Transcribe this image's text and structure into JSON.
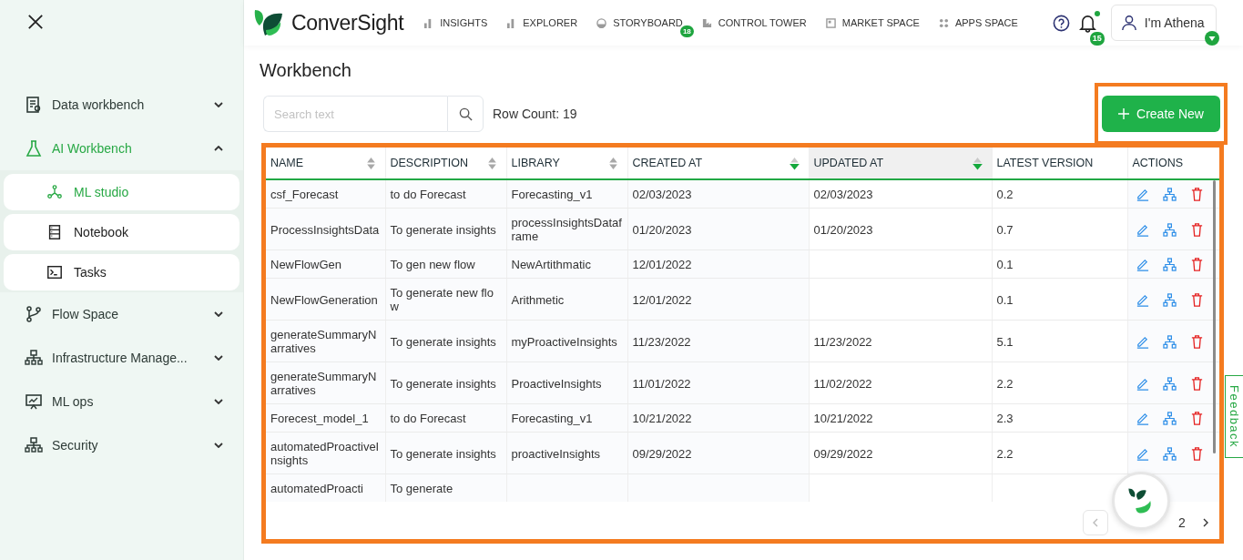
{
  "sidebar": {
    "items": [
      {
        "label": "Data workbench",
        "expanded": false,
        "selected": false
      },
      {
        "label": "AI Workbench",
        "expanded": true,
        "selected": true,
        "children": [
          {
            "label": "ML studio",
            "selected": true
          },
          {
            "label": "Notebook",
            "selected": false
          },
          {
            "label": "Tasks",
            "selected": false
          }
        ]
      },
      {
        "label": "Flow Space",
        "expanded": false,
        "selected": false
      },
      {
        "label": "Infrastructure Manage...",
        "expanded": false,
        "selected": false
      },
      {
        "label": "ML ops",
        "expanded": false,
        "selected": false
      },
      {
        "label": "Security",
        "expanded": false,
        "selected": false
      }
    ]
  },
  "topbar": {
    "logo": "ConverSight",
    "nav": [
      {
        "label": "INSIGHTS"
      },
      {
        "label": "EXPLORER"
      },
      {
        "label": "STORYBOARD",
        "badge": "18"
      },
      {
        "label": "CONTROL TOWER"
      },
      {
        "label": "MARKET SPACE"
      },
      {
        "label": "APPS SPACE"
      }
    ],
    "notifications": {
      "count": "15",
      "unread": true
    },
    "user": {
      "label": "I'm Athena"
    }
  },
  "page": {
    "title": "Workbench",
    "search": {
      "placeholder": "Search text"
    },
    "row_count": "Row Count: 19",
    "create_button": {
      "label": "Create New",
      "highlighted": true
    }
  },
  "table": {
    "highlighted": true,
    "columns": [
      {
        "label": "NAME",
        "sortable": true,
        "sorted_descending": false,
        "active": false
      },
      {
        "label": "DESCRIPTION",
        "sortable": true,
        "sorted_descending": false,
        "active": false
      },
      {
        "label": "LIBRARY",
        "sortable": true,
        "sorted_descending": false,
        "active": false
      },
      {
        "label": "CREATED AT",
        "sortable": true,
        "sorted_descending": true,
        "active": false
      },
      {
        "label": "UPDATED AT",
        "sortable": true,
        "sorted_descending": true,
        "active": true
      },
      {
        "label": "LATEST VERSION",
        "active": false
      },
      {
        "label": "ACTIONS",
        "active": false
      }
    ],
    "rows": [
      {
        "name": "csf_Forecast",
        "description": "to do Forecast",
        "library": "Forecasting_v1",
        "created_at": "02/03/2023",
        "updated_at": "02/03/2023",
        "version": "0.2",
        "actions": true
      },
      {
        "name": "ProcessInsightsData",
        "description": "To generate insights",
        "library": "processInsightsDataframe",
        "created_at": "01/20/2023",
        "updated_at": "01/20/2023",
        "version": "0.7",
        "actions": true
      },
      {
        "name": "NewFlowGen",
        "description": "To gen new flow",
        "library": "NewArtithmatic",
        "created_at": "12/01/2022",
        "version": "0.1",
        "actions": true
      },
      {
        "name": "NewFlowGeneration",
        "description": "To generate new flow",
        "library": "Arithmetic",
        "created_at": "12/01/2022",
        "version": "0.1",
        "actions": true
      },
      {
        "name": "generateSummaryNarratives",
        "description": "To generate insights",
        "library": "myProactiveInsights",
        "created_at": "11/23/2022",
        "updated_at": "11/23/2022",
        "version": "5.1",
        "actions": true
      },
      {
        "name": "generateSummaryNarratives",
        "description": "To generate insights",
        "library": "ProactiveInsights",
        "created_at": "11/01/2022",
        "updated_at": "11/02/2022",
        "version": "2.2",
        "actions": true
      },
      {
        "name": "Forecest_model_1",
        "description": "to do Forecast",
        "library": "Forecasting_v1",
        "created_at": "10/21/2022",
        "updated_at": "10/21/2022",
        "version": "2.3",
        "actions": true
      },
      {
        "name": "automatedProactiveInsights",
        "description": "To generate insights",
        "library": "proactiveInsights",
        "created_at": "09/29/2022",
        "updated_at": "09/29/2022",
        "version": "2.2",
        "actions": true
      },
      {
        "name": "automatedProacti",
        "description": "To generate",
        "actions": false
      }
    ]
  },
  "pagination": {
    "previous_disabled": true,
    "pages": [
      {
        "label": "2",
        "selected": false
      }
    ]
  },
  "feedback": {
    "label": "Feedback"
  }
}
